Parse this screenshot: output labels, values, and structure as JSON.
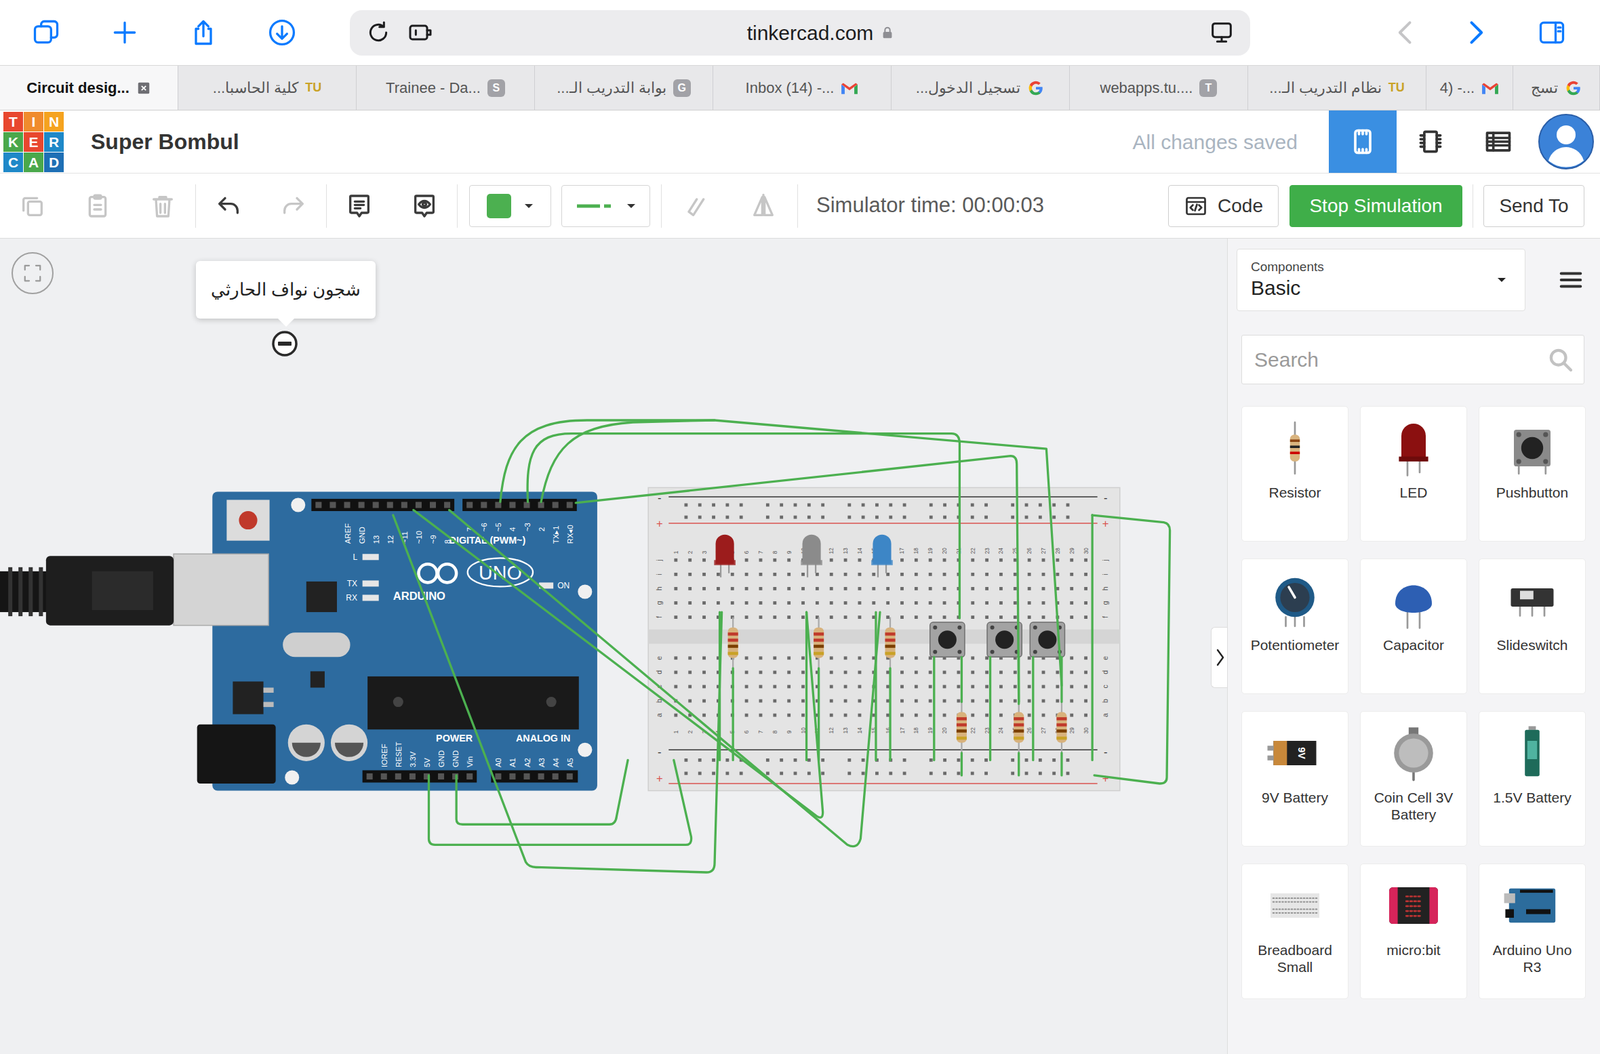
{
  "browser": {
    "url": "tinkercad.com",
    "tabs": [
      {
        "label": "Circuit desig...",
        "selected": true,
        "favicon": {
          "kind": "close"
        }
      },
      {
        "label": "كلية الحاسبا...",
        "selected": false,
        "favicon": {
          "kind": "text",
          "text": "TU",
          "color": "#c9a227"
        }
      },
      {
        "label": "Trainee - Da...",
        "selected": false,
        "favicon": {
          "kind": "badge",
          "text": "S",
          "color": "#a2a2a7"
        }
      },
      {
        "label": "بوابة التدريب الـ...",
        "selected": false,
        "favicon": {
          "kind": "badge",
          "text": "G",
          "color": "#a2a2a7"
        }
      },
      {
        "label": "Inbox (14) -...",
        "selected": false,
        "favicon": {
          "kind": "gmail"
        }
      },
      {
        "label": "تسجيل الدخول...",
        "selected": false,
        "favicon": {
          "kind": "google"
        }
      },
      {
        "label": "webapps.tu....",
        "selected": false,
        "favicon": {
          "kind": "badge",
          "text": "T",
          "color": "#a2a2a7"
        }
      },
      {
        "label": "نظام التدريب الـ...",
        "selected": false,
        "favicon": {
          "kind": "text",
          "text": "TU",
          "color": "#c9a227"
        }
      },
      {
        "label": "4) -...",
        "selected": false,
        "favicon": {
          "kind": "gmail"
        }
      },
      {
        "label": "تسج",
        "selected": false,
        "favicon": {
          "kind": "google"
        }
      }
    ]
  },
  "app": {
    "logo": [
      {
        "letter": "T",
        "color": "#e8472e"
      },
      {
        "letter": "I",
        "color": "#f08b2d"
      },
      {
        "letter": "N",
        "color": "#f5a31f"
      },
      {
        "letter": "K",
        "color": "#4aa84b"
      },
      {
        "letter": "E",
        "color": "#e8472e"
      },
      {
        "letter": "R",
        "color": "#1e88c8"
      },
      {
        "letter": "C",
        "color": "#1e88c8"
      },
      {
        "letter": "A",
        "color": "#4aa84b"
      },
      {
        "letter": "D",
        "color": "#1e6fb5"
      }
    ],
    "design_name": "Super Bombul",
    "save_status": "All changes saved",
    "views": [
      {
        "kind": "circuit",
        "selected": true
      },
      {
        "kind": "schematic",
        "selected": false
      },
      {
        "kind": "list",
        "selected": false
      }
    ]
  },
  "toolbar": {
    "tools": [
      {
        "kind": "copy",
        "disabled": true
      },
      {
        "kind": "paste",
        "disabled": true
      },
      {
        "kind": "delete",
        "disabled": true
      },
      {
        "kind": "undo",
        "disabled": false
      },
      {
        "kind": "redo",
        "disabled": true
      },
      {
        "kind": "note",
        "disabled": false
      },
      {
        "kind": "notes-visible",
        "disabled": false
      }
    ],
    "wire_color": "#4cb050",
    "tools2": [
      {
        "kind": "rotate",
        "disabled": true
      },
      {
        "kind": "mirror",
        "disabled": true
      }
    ],
    "simulator_time": "Simulator time: 00:00:03",
    "code_button": "Code",
    "simulation_button": "Stop Simulation",
    "send_button": "Send To"
  },
  "panel": {
    "category_label": "Components",
    "category": "Basic",
    "search_placeholder": "Search",
    "components": [
      {
        "label": "Resistor",
        "kind": "resistor"
      },
      {
        "label": "LED",
        "kind": "led"
      },
      {
        "label": "Pushbutton",
        "kind": "pushbutton"
      },
      {
        "label": "Potentiometer",
        "kind": "potentiometer"
      },
      {
        "label": "Capacitor",
        "kind": "capacitor"
      },
      {
        "label": "Slideswitch",
        "kind": "slideswitch"
      },
      {
        "label": "9V Battery",
        "kind": "battery9v",
        "icon_text": "9V"
      },
      {
        "label": "Coin Cell 3V Battery",
        "kind": "coincell"
      },
      {
        "label": "1.5V Battery",
        "kind": "battery15v"
      },
      {
        "label": "Breadboard Small",
        "kind": "breadboard"
      },
      {
        "label": "micro:bit",
        "kind": "microbit"
      },
      {
        "label": "Arduino Uno R3",
        "kind": "arduino"
      }
    ]
  },
  "canvas": {
    "note": "شجون نواف الحارثي",
    "arduino": {
      "digital_label": "DIGITAL (PWM~)",
      "brand": "ARDUINO",
      "model": "UNO",
      "on_label": "ON",
      "power_label": "POWER",
      "analog_label": "ANALOG IN",
      "status_leds": [
        "L",
        "TX",
        "RX"
      ],
      "top_pins": [
        "AREF",
        "GND",
        "13",
        "12",
        "~11",
        "~10",
        "~9",
        "8",
        "7",
        "~6",
        "~5",
        "4",
        "~3",
        "2",
        "TX▸1",
        "RX◂0"
      ],
      "bottom_pins": [
        "IOREF",
        "RESET",
        "3.3V",
        "5V",
        "GND",
        "GND",
        "Vin",
        "A0",
        "A1",
        "A2",
        "A3",
        "A4",
        "A5"
      ]
    },
    "breadboard": {
      "rows_top": [
        "j",
        "i",
        "h",
        "g",
        "f"
      ],
      "rows_bottom": [
        "e",
        "d",
        "c",
        "b",
        "a"
      ],
      "columns": [
        "1",
        "2",
        "3",
        "4",
        "5",
        "6",
        "7",
        "8",
        "9",
        "10",
        "11",
        "12",
        "13",
        "14",
        "15",
        "16",
        "17",
        "18",
        "19",
        "20",
        "21",
        "22",
        "23",
        "24",
        "25",
        "26",
        "27",
        "28",
        "29",
        "30"
      ],
      "minus": "-",
      "plus": "+"
    },
    "leds": [
      {
        "color": "#9c1c1c"
      },
      {
        "color": "#8b8b8b"
      },
      {
        "color": "#3d86c6"
      }
    ]
  }
}
